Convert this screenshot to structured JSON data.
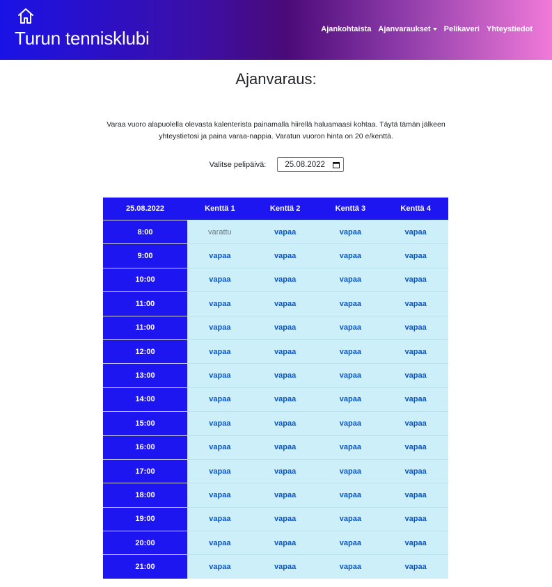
{
  "brand": {
    "title": "Turun tennisklubi"
  },
  "nav": {
    "items": [
      {
        "label": "Ajankohtaista"
      },
      {
        "label": "Ajanvaraukset",
        "dropdown": true
      },
      {
        "label": "Pelikaveri"
      },
      {
        "label": "Yhteystiedot"
      }
    ]
  },
  "page": {
    "title": "Ajanvaraus:",
    "intro": "Varaa vuoro alapuolella olevasta kalenterista painamalla hiirellä haluamaasi kohtaa. Täytä tämän jälkeen yhteystietosi ja paina varaa-nappia. Varatun vuoron hinta on 20 e/kenttä.",
    "date_label": "Valitse pelipäivä:",
    "date_value": "25.08.2022"
  },
  "table": {
    "headers": [
      "25.08.2022",
      "Kenttä 1",
      "Kenttä 2",
      "Kenttä 3",
      "Kenttä 4"
    ],
    "rows": [
      {
        "time": "8:00",
        "slots": [
          "varattu",
          "vapaa",
          "vapaa",
          "vapaa"
        ]
      },
      {
        "time": "9:00",
        "slots": [
          "vapaa",
          "vapaa",
          "vapaa",
          "vapaa"
        ]
      },
      {
        "time": "10:00",
        "slots": [
          "vapaa",
          "vapaa",
          "vapaa",
          "vapaa"
        ]
      },
      {
        "time": "11:00",
        "slots": [
          "vapaa",
          "vapaa",
          "vapaa",
          "vapaa"
        ]
      },
      {
        "time": "11:00",
        "slots": [
          "vapaa",
          "vapaa",
          "vapaa",
          "vapaa"
        ]
      },
      {
        "time": "12:00",
        "slots": [
          "vapaa",
          "vapaa",
          "vapaa",
          "vapaa"
        ]
      },
      {
        "time": "13:00",
        "slots": [
          "vapaa",
          "vapaa",
          "vapaa",
          "vapaa"
        ]
      },
      {
        "time": "14:00",
        "slots": [
          "vapaa",
          "vapaa",
          "vapaa",
          "vapaa"
        ]
      },
      {
        "time": "15:00",
        "slots": [
          "vapaa",
          "vapaa",
          "vapaa",
          "vapaa"
        ]
      },
      {
        "time": "16:00",
        "slots": [
          "vapaa",
          "vapaa",
          "vapaa",
          "vapaa"
        ]
      },
      {
        "time": "17:00",
        "slots": [
          "vapaa",
          "vapaa",
          "vapaa",
          "vapaa"
        ]
      },
      {
        "time": "18:00",
        "slots": [
          "vapaa",
          "vapaa",
          "vapaa",
          "vapaa"
        ]
      },
      {
        "time": "19:00",
        "slots": [
          "vapaa",
          "vapaa",
          "vapaa",
          "vapaa"
        ]
      },
      {
        "time": "20:00",
        "slots": [
          "vapaa",
          "vapaa",
          "vapaa",
          "vapaa"
        ]
      },
      {
        "time": "21:00",
        "slots": [
          "vapaa",
          "vapaa",
          "vapaa",
          "vapaa"
        ]
      }
    ]
  },
  "colors": {
    "header_start": "#1a12e6",
    "header_end": "#f07ad8",
    "table_header": "#1e16f0",
    "slot_bg": "#cdeff9",
    "free_text": "#0a56c8",
    "taken_text": "#6c757d"
  },
  "icons": {
    "home": "home-icon",
    "calendar": "calendar-icon",
    "dropdown": "chevron-down-icon"
  }
}
